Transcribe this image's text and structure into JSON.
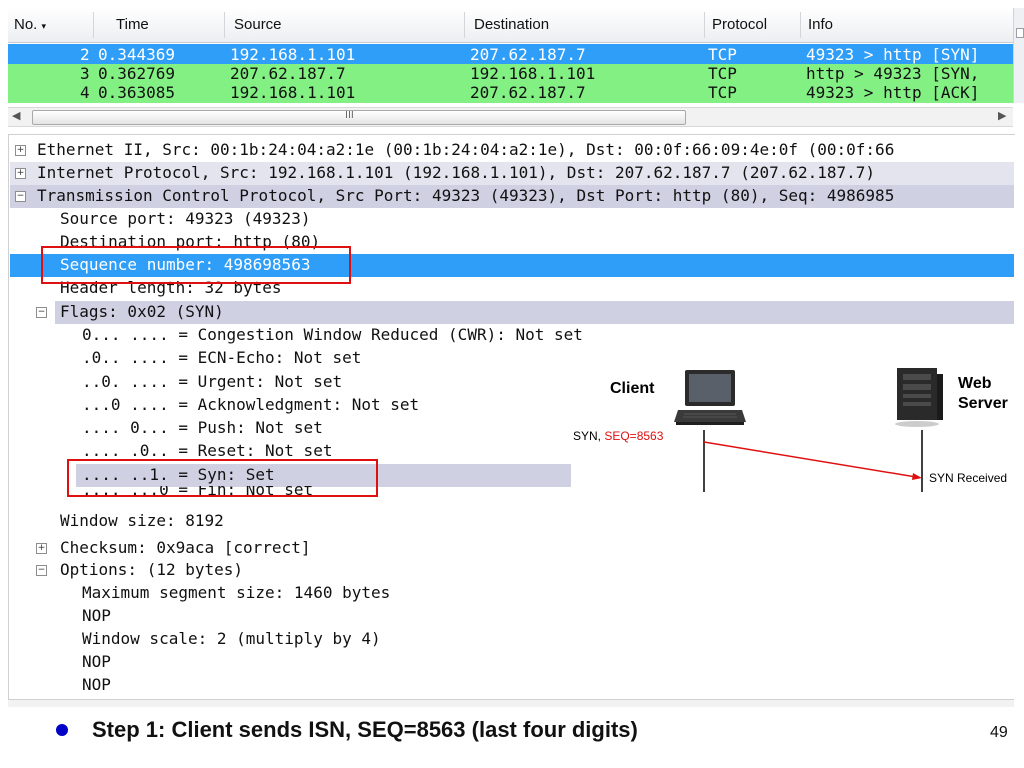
{
  "packet_list": {
    "columns": [
      "No.",
      "Time",
      "Source",
      "Destination",
      "Protocol",
      "Info"
    ],
    "rows": [
      {
        "no": "2",
        "time": "0.344369",
        "source": "192.168.1.101",
        "destination": "207.62.187.7",
        "protocol": "TCP",
        "info": "49323 > http [SYN]"
      },
      {
        "no": "3",
        "time": "0.362769",
        "source": "207.62.187.7",
        "destination": "192.168.1.101",
        "protocol": "TCP",
        "info": "http > 49323 [SYN,"
      },
      {
        "no": "4",
        "time": "0.363085",
        "source": "192.168.1.101",
        "destination": "207.62.187.7",
        "protocol": "TCP",
        "info": "49323 > http [ACK]"
      }
    ]
  },
  "scrollbar": {
    "thumb_label": "III"
  },
  "details": {
    "ethernet": "Ethernet II, Src: 00:1b:24:04:a2:1e (00:1b:24:04:a2:1e), Dst: 00:0f:66:09:4e:0f (00:0f:66",
    "ip": "Internet Protocol, Src: 192.168.1.101 (192.168.1.101), Dst: 207.62.187.7 (207.62.187.7)",
    "tcp": "Transmission Control Protocol, Src Port: 49323 (49323), Dst Port: http (80), Seq: 4986985",
    "source_port": "Source port: 49323 (49323)",
    "destination_port": "Destination port: http (80)",
    "sequence_number": "Sequence number: 498698563",
    "header_length": "Header length: 32 bytes",
    "flags": "Flags: 0x02 (SYN)",
    "flag_cwr": "0... .... = Congestion Window Reduced (CWR): Not set",
    "flag_ecn": ".0.. .... = ECN-Echo: Not set",
    "flag_urg": "..0. .... = Urgent: Not set",
    "flag_ack": "...0 .... = Acknowledgment: Not set",
    "flag_push": ".... 0... = Push: Not set",
    "flag_reset": ".... .0.. = Reset: Not set",
    "flag_syn": ".... ..1. = Syn: Set",
    "flag_fin": ".... ...0 = Fin: Not set",
    "window_size": "Window size: 8192",
    "checksum": "Checksum: 0x9aca [correct]",
    "options": "Options: (12 bytes)",
    "opt_mss": "Maximum segment size: 1460 bytes",
    "opt_nop1": "NOP",
    "opt_wscale": "Window scale: 2 (multiply by 4)",
    "opt_nop2": "NOP",
    "opt_nop3": "NOP"
  },
  "diagram": {
    "client_label": "Client",
    "server_label_1": "Web",
    "server_label_2": "Server",
    "syn_prefix": "SYN, ",
    "seq_label": "SEQ=8563",
    "received_label": "SYN Received"
  },
  "footer": {
    "step": "Step 1: Client sends ISN, SEQ=8563 (last four digits)",
    "page_number": "49"
  },
  "colors": {
    "selected": "#2f9ef8",
    "packet_green": "#83f083",
    "highlight_band": "#d0d0e3",
    "annotation_red": "#e01010"
  }
}
